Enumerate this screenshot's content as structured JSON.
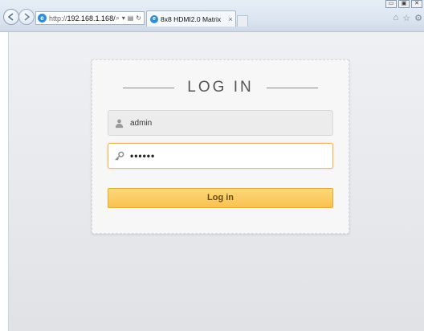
{
  "browser": {
    "url_scheme": "http://",
    "url_host": "192.168.1.168/",
    "address_tools": [
      "⌕",
      "▾",
      "▤",
      "↻"
    ],
    "tab_label": "8x8 HDMI2.0 Matrix",
    "tab_close": "×",
    "window_controls": [
      "▭",
      "▣",
      "✕"
    ],
    "toolbar_icons": [
      "⌂",
      "☆",
      "⚙"
    ]
  },
  "login": {
    "title": "LOG IN",
    "username_value": "admin",
    "password_value": "••••••",
    "submit_label": "Log in"
  },
  "colors": {
    "button_top": "#fcd77a",
    "button_bottom": "#f9c24e",
    "focus_border": "#f0b560",
    "page_bg": "#e6e8ec"
  },
  "icons": {
    "username": "user-icon",
    "password": "key-icon",
    "back": "back-arrow-icon",
    "forward": "forward-arrow-icon"
  }
}
